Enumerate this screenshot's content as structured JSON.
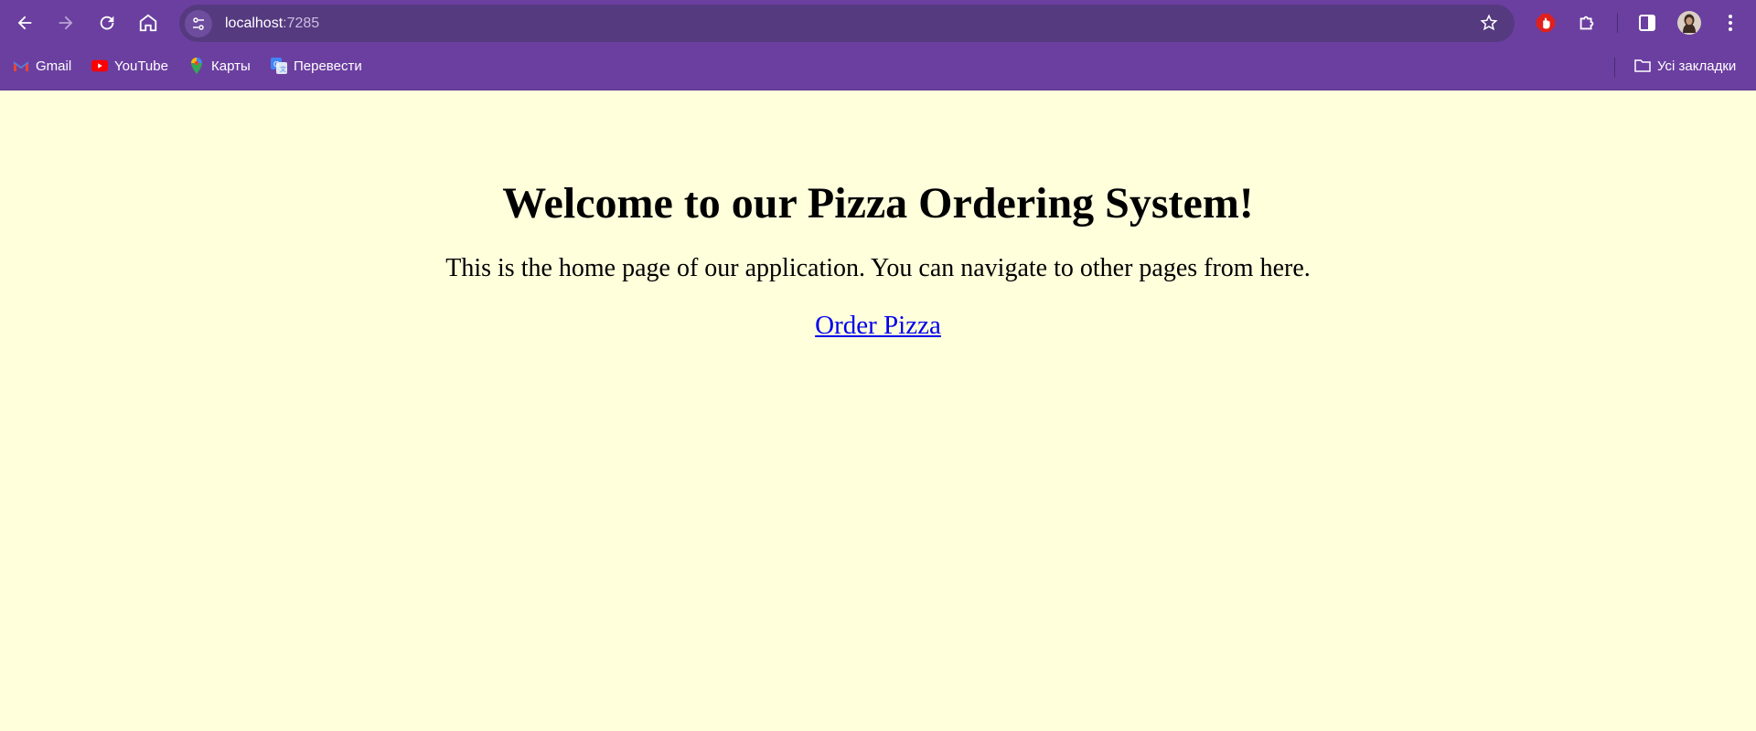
{
  "browser": {
    "url_host": "localhost",
    "url_port": ":7285"
  },
  "bookmarks": [
    {
      "label": "Gmail",
      "icon": "gmail-icon"
    },
    {
      "label": "YouTube",
      "icon": "youtube-icon"
    },
    {
      "label": "Карты",
      "icon": "maps-icon"
    },
    {
      "label": "Перевести",
      "icon": "translate-icon"
    }
  ],
  "all_bookmarks_label": "Усі закладки",
  "page": {
    "heading": "Welcome to our Pizza Ordering System!",
    "intro": "This is the home page of our application. You can navigate to other pages from here.",
    "link_label": "Order Pizza"
  },
  "colors": {
    "chrome": "#6b3fa0",
    "omnibox": "#553a80",
    "page_bg": "#ffffdc",
    "link": "#0000ee"
  }
}
